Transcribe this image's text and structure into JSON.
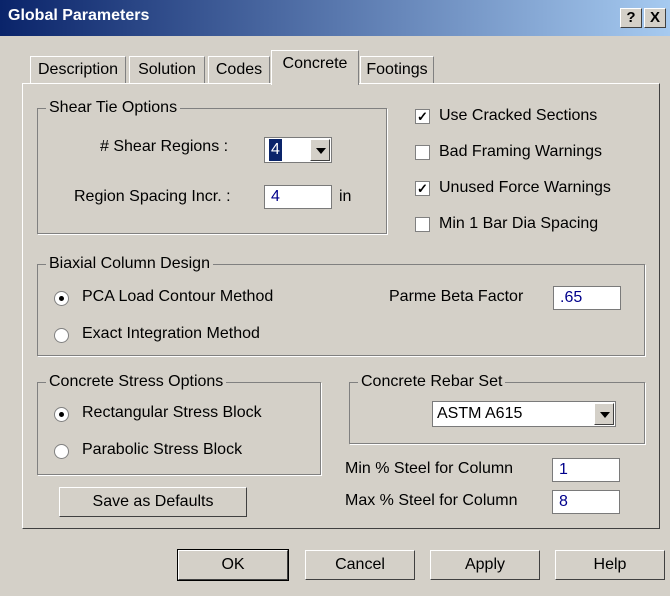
{
  "window": {
    "title": "Global Parameters",
    "help_glyph": "?",
    "close_glyph": "X"
  },
  "tabs": [
    {
      "label": "Description"
    },
    {
      "label": "Solution"
    },
    {
      "label": "Codes"
    },
    {
      "label": "Concrete",
      "active": true
    },
    {
      "label": "Footings"
    }
  ],
  "shear_tie": {
    "legend": "Shear Tie Options",
    "regions_label": "# Shear Regions :",
    "regions_value": "4",
    "spacing_label": "Region Spacing Incr. :",
    "spacing_value": "4",
    "spacing_unit": "in"
  },
  "options": [
    {
      "label": "Use Cracked Sections",
      "checked": true
    },
    {
      "label": "Bad Framing Warnings",
      "checked": false
    },
    {
      "label": "Unused Force Warnings",
      "checked": true
    },
    {
      "label": "Min 1 Bar Dia Spacing",
      "checked": false
    }
  ],
  "biaxial": {
    "legend": "Biaxial Column Design",
    "pca_label": "PCA Load Contour Method",
    "exact_label": "Exact Integration Method",
    "beta_label": "Parme Beta Factor",
    "beta_value": ".65",
    "selected": "pca"
  },
  "stress": {
    "legend": "Concrete Stress Options",
    "rect_label": "Rectangular Stress Block",
    "parab_label": "Parabolic Stress Block",
    "selected": "rect"
  },
  "rebar": {
    "legend": "Concrete Rebar Set",
    "value": "ASTM A615"
  },
  "steel": {
    "min_label": "Min % Steel for Column",
    "min_value": "1",
    "max_label": "Max % Steel for Column",
    "max_value": "8"
  },
  "buttons": {
    "save_defaults": "Save as Defaults",
    "ok": "OK",
    "cancel": "Cancel",
    "apply": "Apply",
    "help": "Help"
  }
}
